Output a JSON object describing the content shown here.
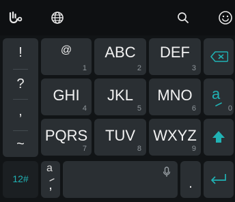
{
  "toolbar": {
    "icons": [
      "touchpal-logo-icon",
      "globe-icon",
      "search-icon",
      "emoji-icon"
    ]
  },
  "side_symbols": [
    "!",
    "?",
    ",",
    "~"
  ],
  "rows": [
    [
      {
        "label": "@",
        "num": "1"
      },
      {
        "label": "ABC",
        "num": "2"
      },
      {
        "label": "DEF",
        "num": "3"
      }
    ],
    [
      {
        "label": "GHI",
        "num": "4"
      },
      {
        "label": "JKL",
        "num": "5"
      },
      {
        "label": "MNO",
        "num": "6"
      }
    ],
    [
      {
        "label": "PQRS",
        "num": "7"
      },
      {
        "label": "TUV",
        "num": "8"
      },
      {
        "label": "WXYZ",
        "num": "9"
      }
    ]
  ],
  "special": {
    "num_mode_label": "12#",
    "smart_key_num": "0",
    "comma_label": ",",
    "period_label": ".",
    "smart_glyph": "a"
  },
  "colors": {
    "accent": "#20b2b4",
    "key_bg": "#2a2f33",
    "bg": "#111416"
  }
}
